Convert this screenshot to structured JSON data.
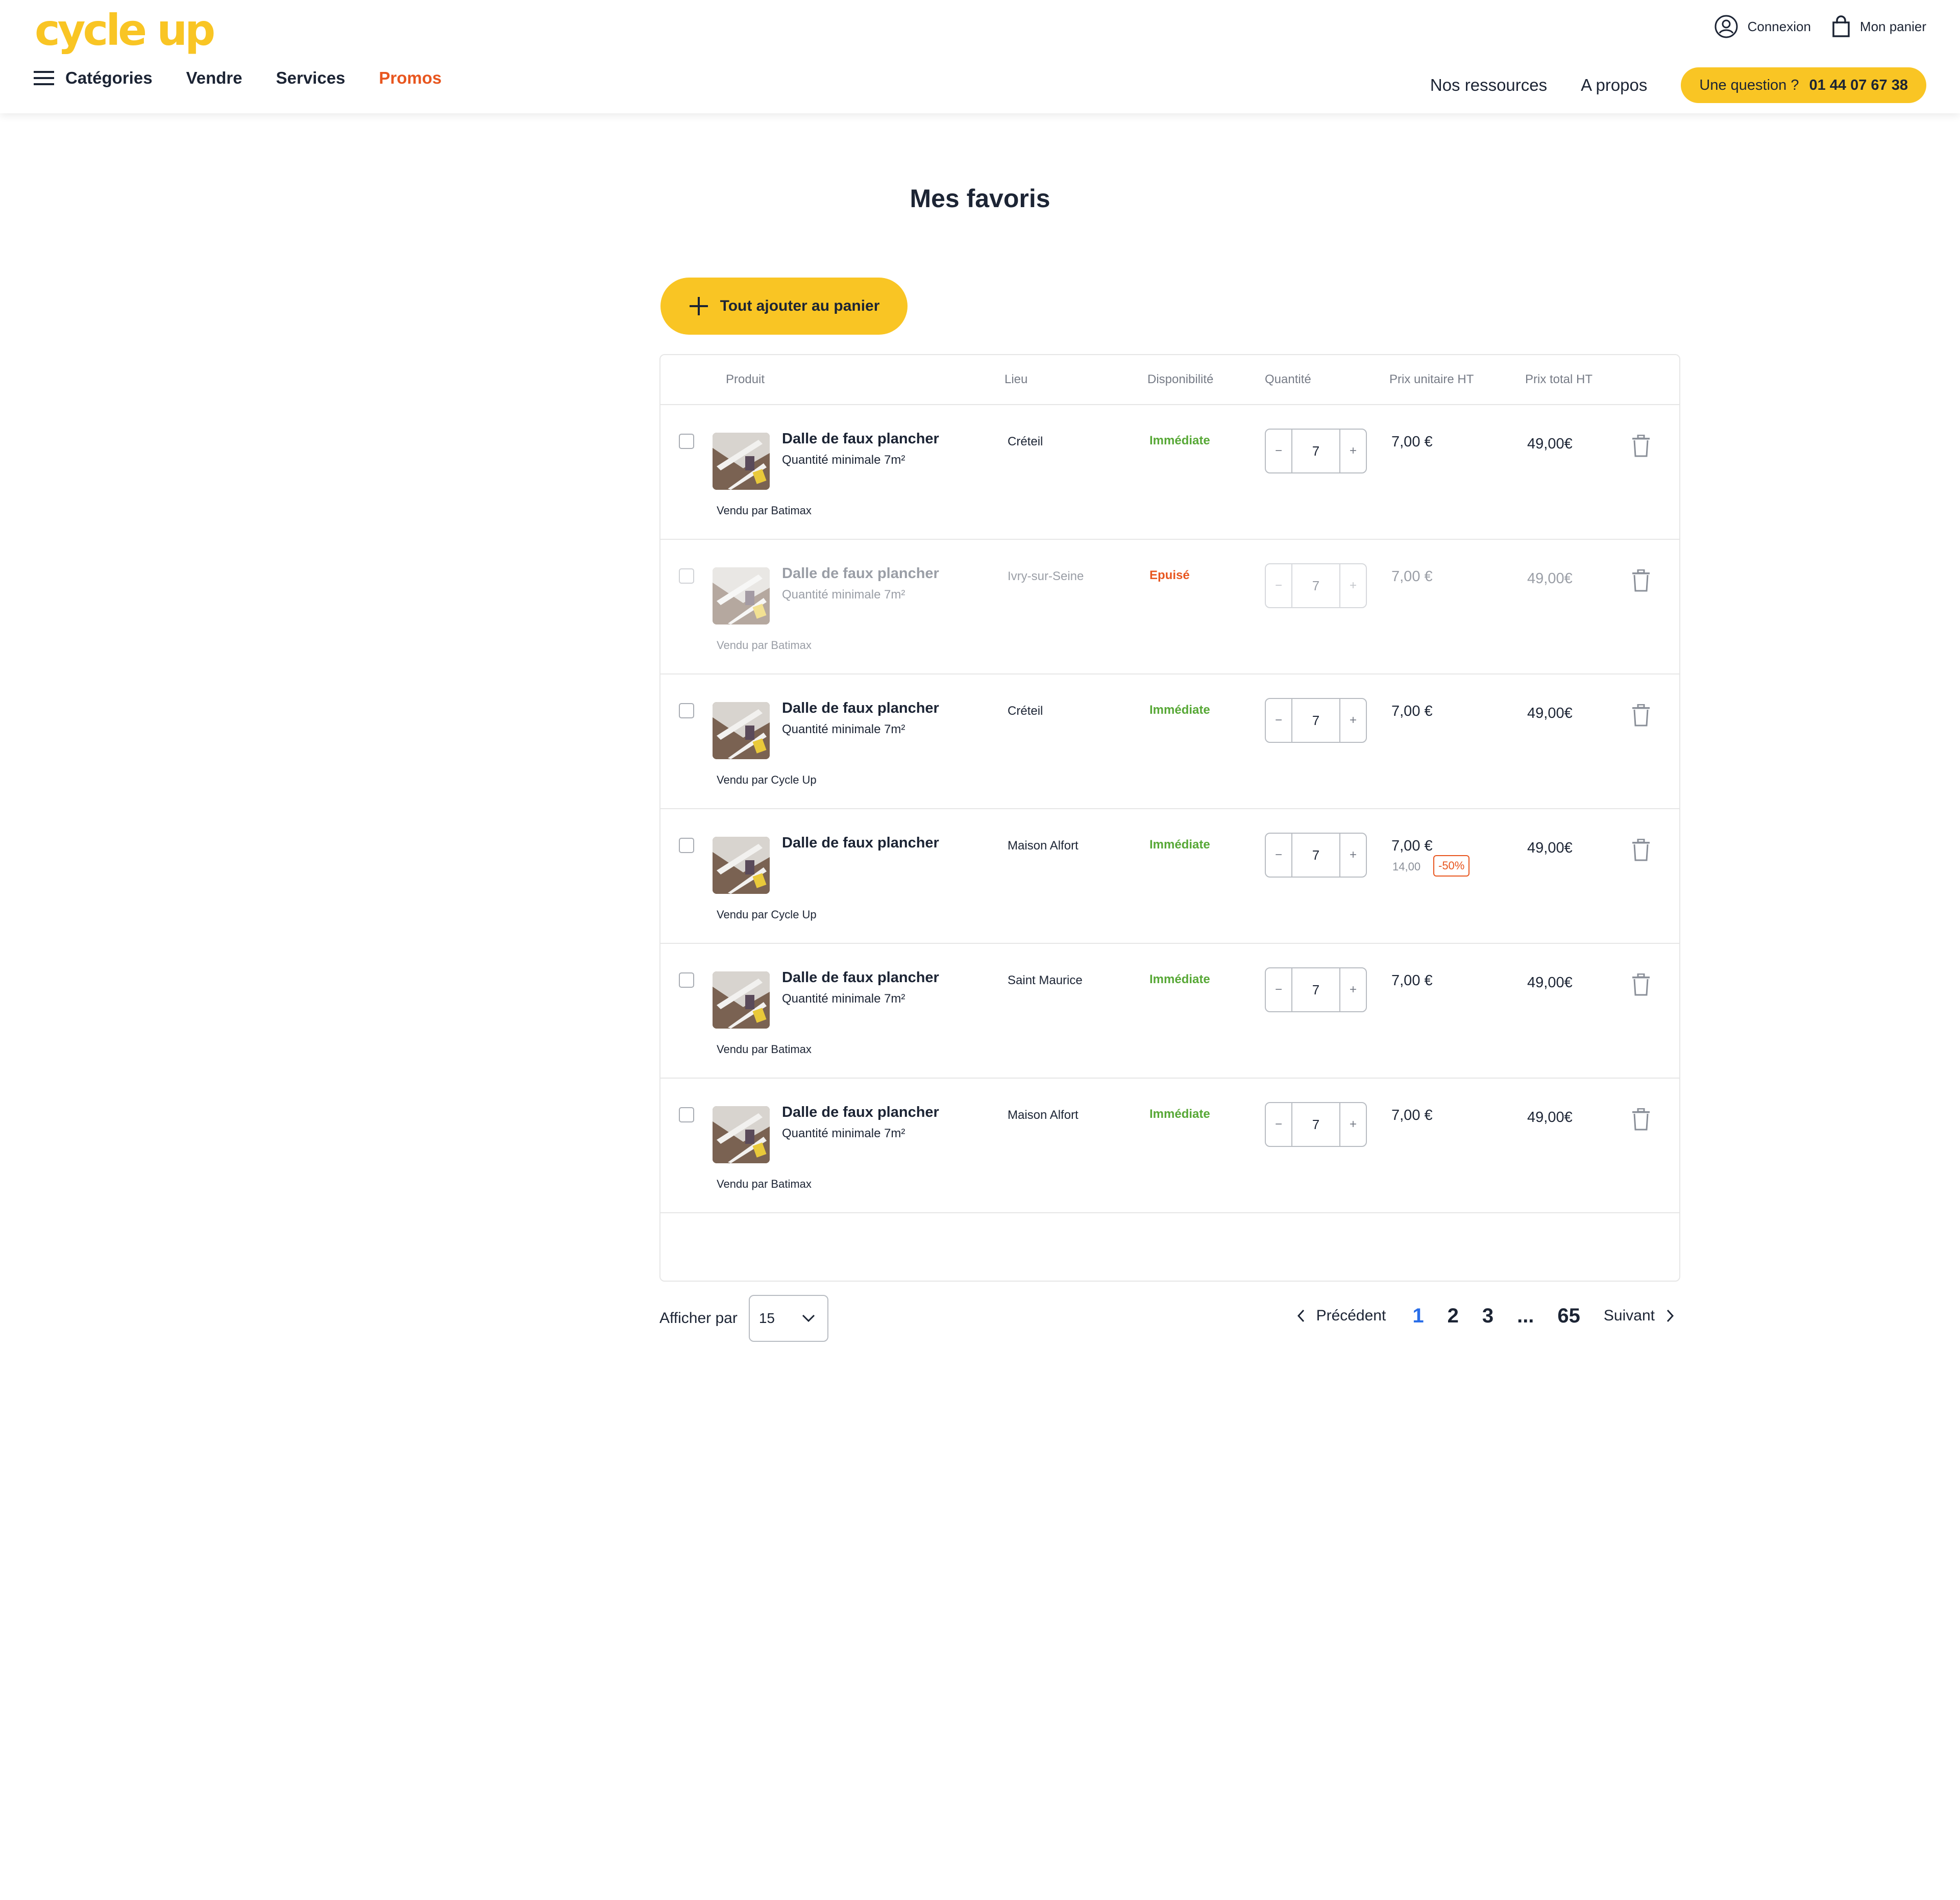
{
  "brand": {
    "logo_text": "cycle up",
    "accent": "#f9c524",
    "promo_color": "#e8561f",
    "success_color": "#57a836"
  },
  "header": {
    "login_label": "Connexion",
    "cart_label": "Mon panier",
    "categories_label": "Catégories",
    "nav": [
      "Vendre",
      "Services",
      "Promos"
    ],
    "nav_right": [
      "Nos ressources",
      "A propos"
    ],
    "question_label": "Une question ?",
    "phone": "01 44 07 67 38"
  },
  "page": {
    "title": "Mes favoris",
    "add_all_label": "Tout ajouter au  panier"
  },
  "table": {
    "columns": [
      "Produit",
      "Lieu",
      "Disponibilité",
      "Quantité",
      "Prix unitaire HT",
      "Prix total HT"
    ],
    "rows": [
      {
        "name": "Dalle de faux plancher",
        "min_qty": "Quantité minimale 7m²",
        "seller": "Vendu par Batimax",
        "lieu": "Créteil",
        "dispo": "Immédiate",
        "qty": "7",
        "price": "7,00 €",
        "old_price": "",
        "discount": "",
        "total": "49,00€"
      },
      {
        "name": "Dalle de faux plancher",
        "min_qty": "Quantité minimale 7m²",
        "seller": "Vendu par Batimax",
        "lieu": "Ivry-sur-Seine",
        "dispo": "Epuisé",
        "qty": "7",
        "price": "7,00 €",
        "old_price": "",
        "discount": "",
        "total": "49,00€"
      },
      {
        "name": "Dalle de faux plancher",
        "min_qty": "Quantité minimale 7m²",
        "seller": "Vendu par Cycle Up",
        "lieu": "Créteil",
        "dispo": "Immédiate",
        "qty": "7",
        "price": "7,00 €",
        "old_price": "",
        "discount": "",
        "total": "49,00€"
      },
      {
        "name": "Dalle de faux plancher",
        "min_qty": "",
        "seller": "Vendu par Cycle Up",
        "lieu": "Maison Alfort",
        "dispo": "Immédiate",
        "qty": "7",
        "price": "7,00 €",
        "old_price": "14,00",
        "discount": "-50%",
        "total": "49,00€"
      },
      {
        "name": "Dalle de faux plancher",
        "min_qty": "Quantité minimale 7m²",
        "seller": "Vendu par Batimax",
        "lieu": "Saint Maurice",
        "dispo": "Immédiate",
        "qty": "7",
        "price": "7,00 €",
        "old_price": "",
        "discount": "",
        "total": "49,00€"
      },
      {
        "name": "Dalle de faux plancher",
        "min_qty": "Quantité minimale 7m²",
        "seller": "Vendu par Batimax",
        "lieu": "Maison Alfort",
        "dispo": "Immédiate",
        "qty": "7",
        "price": "7,00 €",
        "old_price": "",
        "discount": "",
        "total": "49,00€"
      }
    ]
  },
  "footer": {
    "per_page_label": "Afficher par",
    "per_page_value": "15",
    "prev_label": "Précédent",
    "next_label": "Suivant",
    "pages": [
      "1",
      "2",
      "3",
      "...",
      "65"
    ]
  }
}
